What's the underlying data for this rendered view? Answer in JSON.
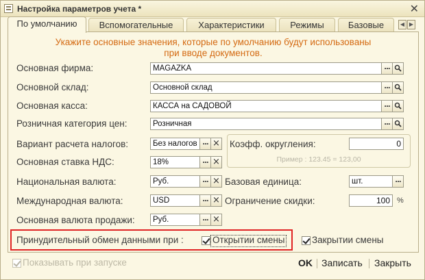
{
  "window": {
    "title": "Настройка параметров учета *"
  },
  "tabs": [
    {
      "label": "По умолчанию",
      "active": true
    },
    {
      "label": "Вспомогательные",
      "active": false
    },
    {
      "label": "Характеристики",
      "active": false
    },
    {
      "label": "Режимы",
      "active": false
    },
    {
      "label": "Базовые",
      "active": false
    }
  ],
  "hint": {
    "line1": "Укажите основные значения, которые по умолчанию будут использованы",
    "line2": "при вводе документов."
  },
  "fields": {
    "main_company": {
      "label": "Основная фирма:",
      "value": "MAGAZKA"
    },
    "main_warehouse": {
      "label": "Основной склад:",
      "value": "Основной склад"
    },
    "main_cash": {
      "label": "Основная касса:",
      "value": "КАССА на САДОВОЙ"
    },
    "price_category": {
      "label": "Розничная категория цен:",
      "value": "Розничная"
    },
    "tax_variant": {
      "label": "Вариант расчета налогов:",
      "value": "Без налогов"
    },
    "vat_rate": {
      "label": "Основная ставка НДС:",
      "value": "18%"
    },
    "national_currency": {
      "label": "Национальная валюта:",
      "value": "Руб."
    },
    "international_currency": {
      "label": "Международная валюта:",
      "value": "USD"
    },
    "sales_currency": {
      "label": "Основная валюта продажи:",
      "value": "Руб."
    },
    "rounding_coeff": {
      "label": "Коэфф. округления:",
      "value": "0"
    },
    "base_unit": {
      "label": "Базовая единица:",
      "value": "шт."
    },
    "discount_limit": {
      "label": "Ограничение скидки:",
      "value": "100"
    }
  },
  "rounding_example": "Пример : 123.45 = 123,00",
  "percent_sign": "%",
  "exchange": {
    "label": "Принудительный обмен данными  при :",
    "on_open_label": "Открытии смены",
    "on_open_checked": true,
    "on_close_label": "Закрытии смены",
    "on_close_checked": true
  },
  "show_on_start": {
    "label": "Показывать при запуске",
    "checked": true
  },
  "buttons": {
    "ok": "OK",
    "save": "Записать",
    "close": "Закрыть",
    "select": "...",
    "clear": "×"
  },
  "icons": {
    "close_window": "✕",
    "tab_left": "◀",
    "tab_right": "▶"
  },
  "colors": {
    "hint": "#d46a12",
    "highlight": "#e02424",
    "background": "#fbf7e3"
  }
}
